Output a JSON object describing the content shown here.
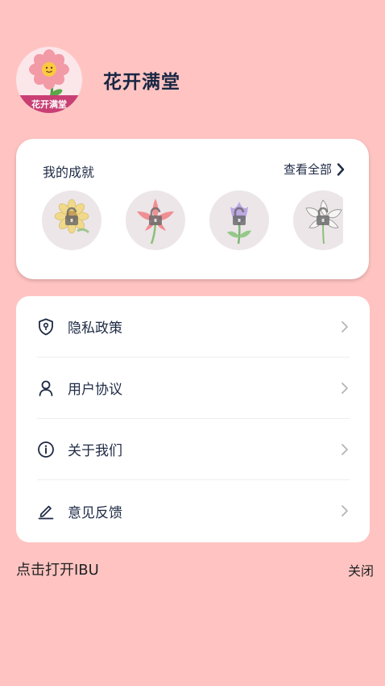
{
  "profile": {
    "username": "花开满堂",
    "avatar_banner": "花开满堂"
  },
  "achievements": {
    "title": "我的成就",
    "view_all": "查看全部",
    "badges": [
      {
        "icon": "sunflower-locked-badge-icon",
        "color": "#f1d77a",
        "locked": true
      },
      {
        "icon": "lily-locked-badge-icon",
        "color": "#f07a80",
        "locked": true
      },
      {
        "icon": "tulip-locked-badge-icon",
        "color": "#b39be0",
        "locked": true
      },
      {
        "icon": "white-flower-locked-badge-icon",
        "color": "#f3f0ef",
        "locked": true
      }
    ]
  },
  "menu": {
    "items": [
      {
        "label": "隐私政策",
        "icon": "shield-lock-icon"
      },
      {
        "label": "用户协议",
        "icon": "user-icon"
      },
      {
        "label": "关于我们",
        "icon": "info-icon"
      },
      {
        "label": "意见反馈",
        "icon": "edit-pen-icon"
      }
    ]
  },
  "footer": {
    "open_ibu": "点击打开IBU",
    "close": "关闭"
  },
  "colors": {
    "background": "#ffc4c2",
    "card": "#ffffff",
    "text": "#1e2a44"
  }
}
